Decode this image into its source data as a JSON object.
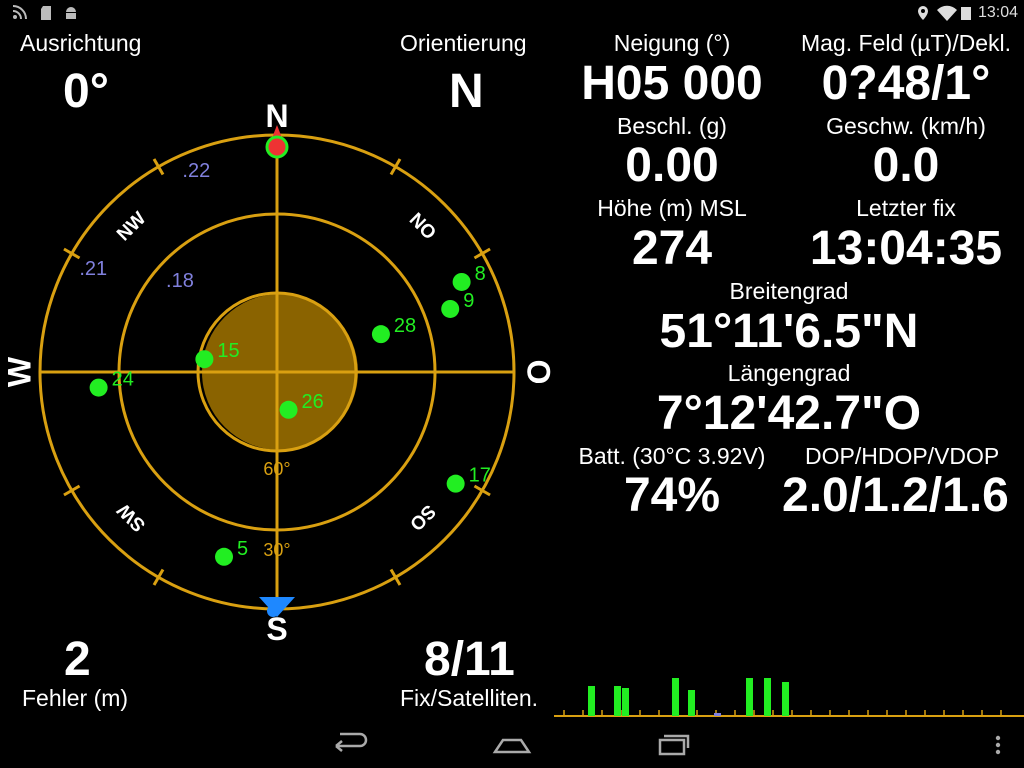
{
  "statusbar": {
    "time": "13:04",
    "left_icons": [
      "signal-scan-icon",
      "sd-card-icon",
      "android-icon"
    ],
    "right_icons": [
      "location-icon",
      "wifi-icon",
      "battery-icon"
    ]
  },
  "left": {
    "heading_label": "Ausrichtung",
    "heading_value": "0°",
    "orientation_label": "Orientierung",
    "orientation_value": "N",
    "error_value": "2",
    "error_label": "Fehler (m)",
    "fix_value": "8/11",
    "fix_label": "Fix/Satelliten."
  },
  "right": {
    "tilt_label": "Neigung (°)",
    "tilt_value": "H05 000",
    "mag_label": "Mag. Feld (µT)/Dekl.",
    "mag_value": "0?48/1°",
    "accel_label": "Beschl. (g)",
    "accel_value": "0.00",
    "speed_label": "Geschw. (km/h)",
    "speed_value": "0.0",
    "altitude_label": "Höhe (m) MSL",
    "altitude_value": "274",
    "lastfix_label": "Letzter fix",
    "lastfix_value": "13:04:35",
    "lat_label": "Breitengrad",
    "lat_value": "51°11'6.5\"N",
    "lon_label": "Längengrad",
    "lon_value": "7°12'42.7\"O",
    "batt_label": "Batt. (30°C 3.92V)",
    "batt_value": "74%",
    "dop_label": "DOP/HDOP/VDOP",
    "dop_value": "2.0/1.2/1.6"
  },
  "radar": {
    "cardinals": {
      "n": "N",
      "s": "S",
      "w": "W",
      "o": "O"
    },
    "intercardinals": {
      "nw": "NW",
      "no": "NO",
      "sw": "SW",
      "so": "SO"
    },
    "ring_labels": [
      "60°",
      "30°"
    ],
    "colors": {
      "ring": "#d9a011",
      "used": "#22ee22",
      "unused": "#8080dd",
      "north": "#ee3333",
      "south": "#1e88ff",
      "error_disc": "#8a6300"
    },
    "satellites": [
      {
        "id": "22",
        "azimuth": 335,
        "elevation": 5,
        "used": false
      },
      {
        "id": "21",
        "azimuth": 298,
        "elevation": 5,
        "used": false
      },
      {
        "id": "18",
        "azimuth": 310,
        "elevation": 35,
        "used": false
      },
      {
        "id": "8",
        "azimuth": 64,
        "elevation": 12,
        "used": true
      },
      {
        "id": "9",
        "azimuth": 70,
        "elevation": 20,
        "used": true
      },
      {
        "id": "28",
        "azimuth": 70,
        "elevation": 48,
        "used": true
      },
      {
        "id": "15",
        "azimuth": 280,
        "elevation": 62,
        "used": true
      },
      {
        "id": "26",
        "azimuth": 163,
        "elevation": 75,
        "used": true
      },
      {
        "id": "24",
        "azimuth": 265,
        "elevation": 22,
        "used": true
      },
      {
        "id": "17",
        "azimuth": 122,
        "elevation": 10,
        "used": true
      },
      {
        "id": "5",
        "azimuth": 196,
        "elevation": 17,
        "used": true
      }
    ]
  },
  "snr_bars": [
    {
      "value": 30,
      "used": true
    },
    {
      "value": 30,
      "used": true
    },
    {
      "value": 28,
      "used": true
    },
    {
      "value": 38,
      "used": true
    },
    {
      "value": 26,
      "used": true
    },
    {
      "value": 3,
      "used": false
    },
    {
      "value": 38,
      "used": true
    },
    {
      "value": 38,
      "used": true
    },
    {
      "value": 34,
      "used": true
    }
  ]
}
